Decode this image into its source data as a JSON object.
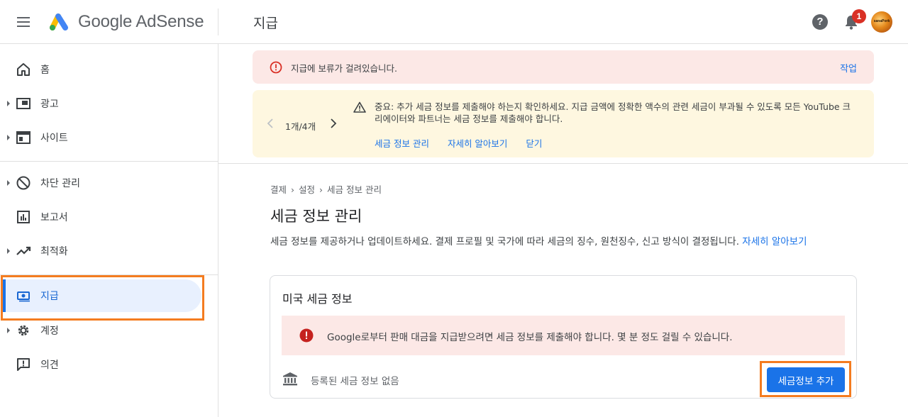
{
  "app": {
    "brand": "Google AdSense",
    "page_title": "지급"
  },
  "header": {
    "menu_icon": "hamburger-icon",
    "help_icon": "help-icon",
    "bell_icon": "bell-icon",
    "notification_count": "1",
    "avatar_text": "sanaPork"
  },
  "sidebar": {
    "items": [
      {
        "label": "홈",
        "icon": "home-icon",
        "expandable": false
      },
      {
        "label": "광고",
        "icon": "ad-icon",
        "expandable": true
      },
      {
        "label": "사이트",
        "icon": "site-icon",
        "expandable": true
      },
      {
        "label": "차단 관리",
        "icon": "block-icon",
        "expandable": true
      },
      {
        "label": "보고서",
        "icon": "report-icon",
        "expandable": false
      },
      {
        "label": "최적화",
        "icon": "trend-icon",
        "expandable": true
      },
      {
        "label": "지급",
        "icon": "payment-icon",
        "expandable": false,
        "active": true
      },
      {
        "label": "계정",
        "icon": "gear-icon",
        "expandable": true
      },
      {
        "label": "의견",
        "icon": "feedback-icon",
        "expandable": false
      }
    ]
  },
  "error_banner": {
    "text": "지급에 보류가 걸려있습니다.",
    "action": "작업"
  },
  "warning_banner": {
    "pager": "1개/4개",
    "text": "중요: 추가 세금 정보를 제출해야 하는지 확인하세요. 지급 금액에 정확한 액수의 관련 세금이 부과될 수 있도록 모든 YouTube 크리에이터와 파트너는 세금 정보를 제출해야 합니다.",
    "links": [
      "세금 정보 관리",
      "자세히 알아보기",
      "닫기"
    ]
  },
  "breadcrumb": [
    "결제",
    "설정",
    "세금 정보 관리"
  ],
  "section": {
    "title": "세금 정보 관리",
    "description": "세금 정보를 제공하거나 업데이트하세요. 결제 프로필 및 국가에 따라 세금의 징수, 원천징수, 신고 방식이 결정됩니다.",
    "learn_more": "자세히 알아보기"
  },
  "card": {
    "title": "미국 세금 정보",
    "error_text": "Google로부터 판매 대금을 지급받으려면 세금 정보를 제출해야 합니다. 몇 분 정도 걸릴 수 있습니다.",
    "empty_text": "등록된 세금 정보 없음",
    "button": "세금정보 추가"
  },
  "colors": {
    "accent": "#1a73e8",
    "error_bg": "#fce8e6",
    "warning_bg": "#fef7e0",
    "highlight": "#f47c20"
  }
}
